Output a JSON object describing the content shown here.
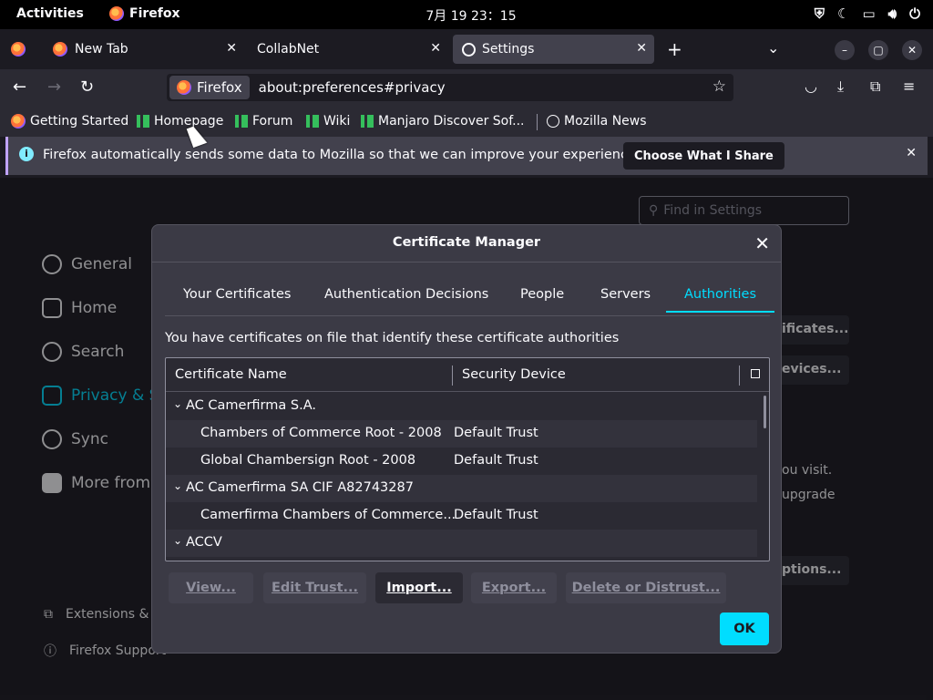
{
  "topbar": {
    "activities": "Activities",
    "app_name": "Firefox",
    "clock": "7月 19  23：15"
  },
  "tabs": [
    {
      "label": "New Tab"
    },
    {
      "label": "CollabNet"
    },
    {
      "label": "Settings"
    }
  ],
  "navbar": {
    "identity": "Firefox",
    "url": "about:preferences#privacy"
  },
  "bookmarks": [
    "Getting Started",
    "Homepage",
    "Forum",
    "Wiki",
    "Manjaro Discover Sof...",
    "Mozilla News"
  ],
  "notification": {
    "message": "Firefox automatically sends some data to Mozilla so that we can improve your experience.",
    "button": "Choose What I Share"
  },
  "settings": {
    "search_placeholder": "Find in Settings",
    "sidebar": [
      "General",
      "Home",
      "Search",
      "Privacy & Se",
      "Sync",
      "More from M"
    ],
    "footer": [
      "Extensions & T",
      "Firefox Support"
    ],
    "bg_buttons": [
      "ificates...",
      "evices...",
      "ptions..."
    ],
    "bg_text": [
      "ou visit.",
      "upgrade"
    ]
  },
  "dialog": {
    "title": "Certificate Manager",
    "tabs": [
      "Your Certificates",
      "Authentication Decisions",
      "People",
      "Servers",
      "Authorities"
    ],
    "description": "You have certificates on file that identify these certificate authorities",
    "columns": [
      "Certificate Name",
      "Security Device"
    ],
    "rows": [
      {
        "name": "AC Camerfirma S.A.",
        "device": "",
        "group": true
      },
      {
        "name": "Chambers of Commerce Root - 2008",
        "device": "Default Trust",
        "group": false
      },
      {
        "name": "Global Chambersign Root - 2008",
        "device": "Default Trust",
        "group": false
      },
      {
        "name": "AC Camerfirma SA CIF A82743287",
        "device": "",
        "group": true
      },
      {
        "name": "Camerfirma Chambers of Commerce...",
        "device": "Default Trust",
        "group": false
      },
      {
        "name": "ACCV",
        "device": "",
        "group": true
      }
    ],
    "buttons": [
      "View...",
      "Edit Trust...",
      "Import...",
      "Export...",
      "Delete or Distrust..."
    ],
    "ok": "OK"
  },
  "colors": {
    "accent": "#00ddff",
    "dialog_bg": "#3b3a45",
    "page_bg": "#1c1b22"
  }
}
